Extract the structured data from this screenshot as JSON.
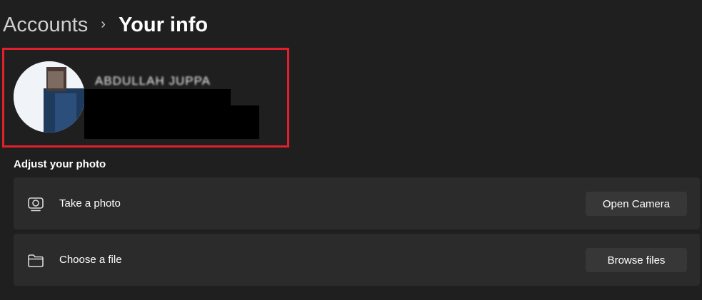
{
  "breadcrumb": {
    "parent": "Accounts",
    "separator": "›",
    "current": "Your info"
  },
  "profile": {
    "name_display": "ABDULLAH JUPPA",
    "highlight_color": "#e0202a"
  },
  "adjust_photo": {
    "title": "Adjust your photo",
    "items": [
      {
        "icon": "camera-icon",
        "label": "Take a photo",
        "button": "Open Camera"
      },
      {
        "icon": "folder-icon",
        "label": "Choose a file",
        "button": "Browse files"
      }
    ]
  },
  "colors": {
    "background": "#1f1f1f",
    "card": "#2b2b2b",
    "button": "#373737"
  }
}
